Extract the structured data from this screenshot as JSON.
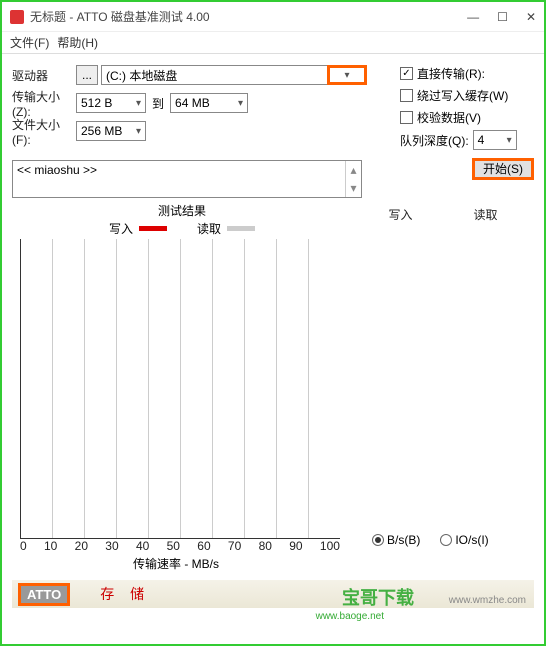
{
  "window": {
    "title": "无标题 - ATTO 磁盘基准测试 4.00"
  },
  "menu": {
    "file": "文件(F)",
    "help": "帮助(H)"
  },
  "form": {
    "drive_label": "驱动器",
    "browse": "...",
    "drive_value": "(C:) 本地磁盘",
    "transfer_label": "传输大小(Z):",
    "transfer_from": "512 B",
    "to": "到",
    "transfer_to": "64 MB",
    "file_label": "文件大小(F):",
    "file_size": "256 MB"
  },
  "options": {
    "direct_io": "直接传输(R):",
    "bypass_cache": "绕过写入缓存(W)",
    "verify": "校验数据(V)",
    "queue_label": "队列深度(Q):",
    "queue_value": "4",
    "start": "开始(S)"
  },
  "desc": {
    "text": "<< miaoshu >>"
  },
  "chart_data": {
    "type": "bar",
    "title": "测试结果",
    "series": [
      {
        "name": "写入",
        "values": []
      },
      {
        "name": "读取",
        "values": []
      }
    ],
    "categories": [],
    "xlabel": "传输速率 - MB/s",
    "x_ticks": [
      "0",
      "10",
      "20",
      "30",
      "40",
      "50",
      "60",
      "70",
      "80",
      "90",
      "100"
    ],
    "xlim": [
      0,
      100
    ]
  },
  "legend": {
    "write": "写入",
    "read": "读取"
  },
  "results": {
    "write": "写入",
    "read": "读取"
  },
  "units": {
    "bytes": "B/s(B)",
    "io": "IO/s(I)"
  },
  "footer": {
    "logo": "ATTO",
    "text": "存 储",
    "wmzhe": "www.wmzhe.com",
    "watermark": "宝哥下载",
    "watermark_sub": "www.baoge.net"
  }
}
